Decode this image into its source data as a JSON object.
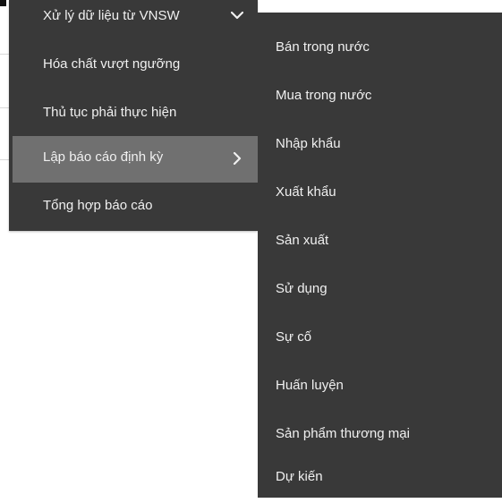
{
  "main_menu": {
    "items": [
      {
        "label": "Xử lý dữ liệu từ VNSW",
        "icon": "chevron-down-icon"
      },
      {
        "label": "Hóa chất vượt ngưỡng"
      },
      {
        "label": "Thủ tục phải thực hiện"
      },
      {
        "label": "Lập báo cáo định kỳ",
        "icon": "chevron-right-icon",
        "active": true
      },
      {
        "label": "Tổng hợp báo cáo"
      }
    ]
  },
  "sub_menu": {
    "items": [
      {
        "label": "Bán trong nước"
      },
      {
        "label": "Mua trong nước"
      },
      {
        "label": "Nhập khẩu"
      },
      {
        "label": "Xuất khẩu"
      },
      {
        "label": "Sản xuất"
      },
      {
        "label": "Sử dụng"
      },
      {
        "label": "Sự cố"
      },
      {
        "label": "Huấn luyện"
      },
      {
        "label": "Sản phẩm thương mại"
      },
      {
        "label": "Dự kiến"
      }
    ]
  },
  "colors": {
    "menu_bg": "#393939",
    "active_bg": "#707070",
    "text": "#f0f0f0"
  }
}
